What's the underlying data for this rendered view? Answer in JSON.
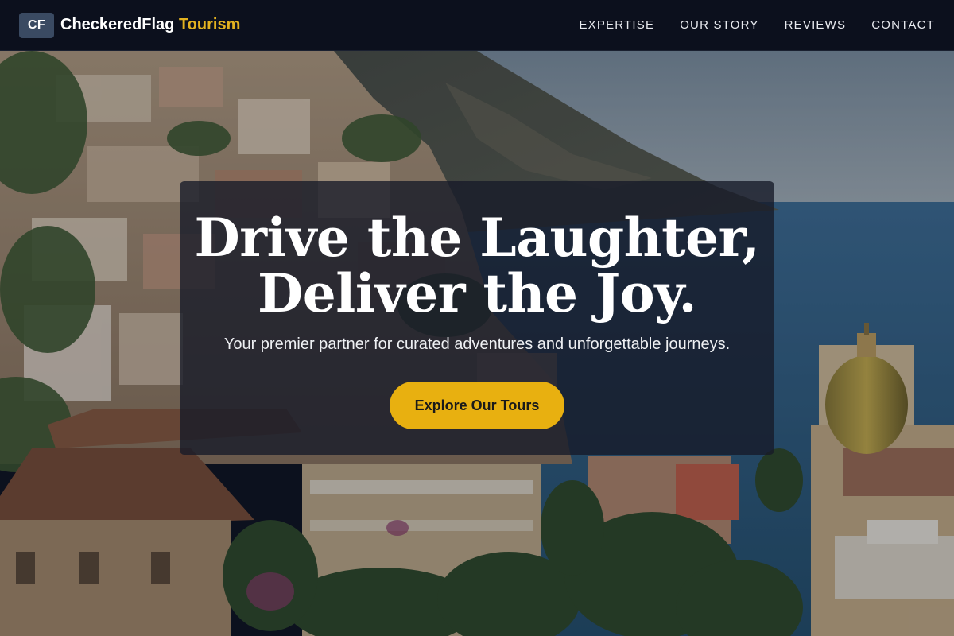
{
  "brand": {
    "badge": "CF",
    "name": "CheckeredFlag",
    "accent": "Tourism"
  },
  "nav": {
    "links": [
      "EXPERTISE",
      "OUR STORY",
      "REVIEWS",
      "CONTACT"
    ]
  },
  "hero": {
    "headline_line1": "Drive the Laughter,",
    "headline_line2": "Deliver the Joy.",
    "subtitle": "Your premier partner for curated adventures and unforgettable journeys.",
    "cta_label": "Explore Our Tours"
  },
  "colors": {
    "header_bg": "#0c101d",
    "accent": "#e3b220",
    "cta_bg": "#e8b010"
  }
}
